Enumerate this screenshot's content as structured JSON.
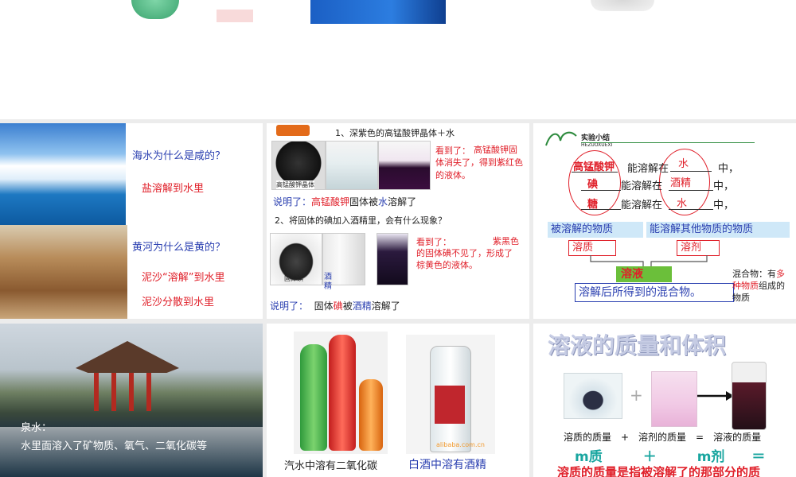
{
  "top_strip": {
    "watermark": ""
  },
  "s1": {
    "q1": "海水为什么是咸的？",
    "a1": "盐溶解到水里",
    "q2": "黄河为什么是黄的？",
    "a2": "泥沙“溶解”到水里",
    "a3": "泥沙分散到水里"
  },
  "s2": {
    "exp1_title": "1、深紫色的高锰酸钾晶体＋水",
    "photo1_caption": "高锰酸钾晶体",
    "obs1_label": "看到了：",
    "obs1_text": "高锰酸钾固体消失了，得到紫红色的液体。",
    "expl1_label": "说明了：",
    "expl1_a": "高锰酸钾",
    "expl1_b": "固体被",
    "expl1_c": "水",
    "expl1_d": "溶解了",
    "exp2_title": "2、将固体的碘加入酒精里，会有什么现象？",
    "photo2_caption": "固体碘",
    "alcohol_label": "酒精",
    "obs2_label": "看到了：",
    "obs2_text": "紫黑色的固体碘不见了，形成了棕黄色的液体。",
    "expl2_label": "说明了：",
    "expl2_a": "固体",
    "expl2_b": "碘",
    "expl2_c": "被",
    "expl2_d": "酒精",
    "expl2_e": "溶解了"
  },
  "s3": {
    "header_title": "实验小结",
    "header_sub": "HEZUOXUEXI",
    "solute1": "高锰酸钾",
    "solute2": "碘",
    "solute3": "糖",
    "can_dissolve_in": "能溶解在",
    "solvent1": "水",
    "solvent2": "酒精",
    "solvent3": "水",
    "tail": "中，",
    "box_dissolved": "被溶解的物质",
    "box_dissolving": "能溶解其他物质的物质",
    "solute_label": "溶质",
    "solvent_label": "溶剂",
    "solution_label": "溶液",
    "definition": "溶解后所得到的混合物。",
    "mixture_note_a": "混合物：有",
    "mixture_note_b": "多种物质",
    "mixture_note_c": "组成的物质"
  },
  "s4": {
    "label_title": "泉水：",
    "label_text": "水里面溶入了矿物质、氧气、二氧化碳等"
  },
  "s5": {
    "caption_left": "汽水中溶有二氧化碳",
    "caption_right": "白酒中溶有酒精",
    "watermark": "alibaba.com.cn"
  },
  "s6": {
    "title": "溶液的质量和体积",
    "plus": "+",
    "formula": "溶质的质量　+　溶剂的质量　=　溶液的质量",
    "big_row": "m质　　　＋　　　m剂　　＝",
    "bottom_note": "溶质的质量是指被溶解了的那部分的质"
  },
  "colors": {
    "accent_blue": "#2a3fb0",
    "accent_red": "#e0202a",
    "green_box": "#6bbf3a"
  }
}
